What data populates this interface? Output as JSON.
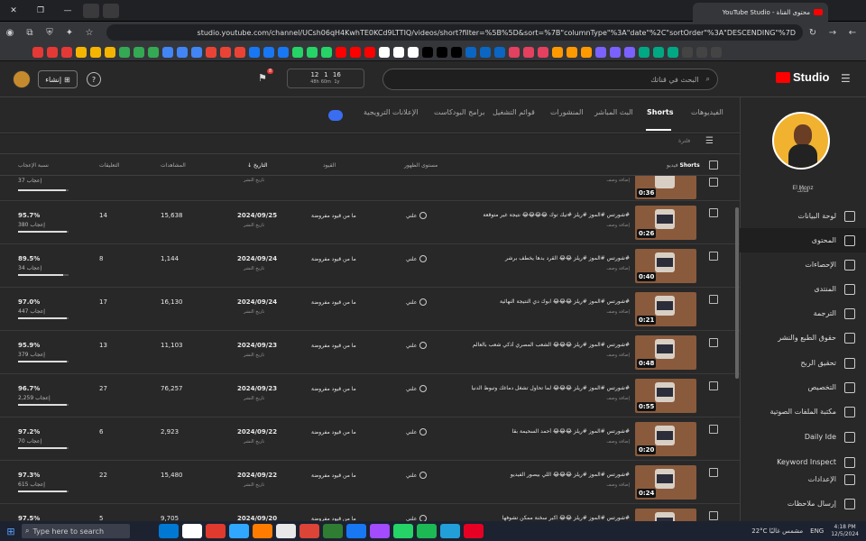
{
  "browser": {
    "tab_title": "محتوى القناة - YouTube Studio",
    "url": "studio.youtube.com/channel/UCsh06qH4KwhTE0KCd9LTTIQ/videos/short?filter=%5B%5D&sort=%7B\"columnType\"%3A\"date\"%2C\"sortOrder\"%3A\"DESCENDING\"%7D",
    "bookmark_colors": [
      "#e53935",
      "#f4b400",
      "#34a853",
      "#4285f4",
      "#ea4335",
      "#1877f2",
      "#25d366",
      "#ff0000",
      "#ffffff",
      "#000000",
      "#0a66c2",
      "#e4405f",
      "#ff9900",
      "#7b61ff",
      "#00a884",
      "#444444"
    ]
  },
  "header": {
    "search_placeholder": "البحث في قناتك",
    "logo_text": "Studio",
    "create_label": "إنشاء",
    "help_label": "?",
    "stats": [
      {
        "value": "12",
        "unit": "48h"
      },
      {
        "value": "1",
        "unit": "60m"
      },
      {
        "value": "16",
        "unit": "1y"
      }
    ],
    "notif_count": "8"
  },
  "channel": {
    "name": "El Monz",
    "subtitle": "قناتك"
  },
  "sidebar": {
    "items": [
      {
        "label": "لوحة البيانات",
        "icon": "dashboard-icon"
      },
      {
        "label": "المحتوى",
        "icon": "content-icon",
        "active": true
      },
      {
        "label": "الإحصاءات",
        "icon": "analytics-icon"
      },
      {
        "label": "المنتدى",
        "icon": "community-icon"
      },
      {
        "label": "الترجمة",
        "icon": "subtitles-icon"
      },
      {
        "label": "حقوق الطبع والنشر",
        "icon": "copyright-icon"
      },
      {
        "label": "تحقيق الربح",
        "icon": "earn-icon"
      },
      {
        "label": "التخصيص",
        "icon": "customization-icon"
      },
      {
        "label": "مكتبة الملفات الصوتية",
        "icon": "audio-library-icon"
      },
      {
        "label": "Daily Ide",
        "icon": "extension-icon"
      },
      {
        "label": "Keyword Inspect",
        "icon": "extension-icon"
      },
      {
        "label": "الإعدادات",
        "icon": "settings-icon"
      },
      {
        "label": "إرسال ملاحظات",
        "icon": "feedback-icon"
      }
    ]
  },
  "tabs": [
    {
      "label": "الفيديوهات"
    },
    {
      "label": "Shorts",
      "active": true
    },
    {
      "label": "البث المباشر"
    },
    {
      "label": "المنشورات"
    },
    {
      "label": "قوائم التشغيل"
    },
    {
      "label": "برامج البودكاست"
    },
    {
      "label": "الإعلانات الترويجية"
    }
  ],
  "filter_label": "فلترة",
  "columns": {
    "video": "Shorts",
    "video_prefix": "فيديو",
    "visibility": "مستوى الظهور",
    "restrictions": "القيود",
    "date": "التاريخ",
    "views": "المشاهدات",
    "comments": "التعليقات",
    "likes": "نسبة الإعجاب"
  },
  "first_row_partial": {
    "likes": "37",
    "likes_label": "إعجاب",
    "duration": "0:36",
    "desc": "إضافة وصف",
    "date_sub": "تاريخ النشر"
  },
  "rows": [
    {
      "duration": "0:26",
      "title": "#شورتس #الموز #ريلز #تيك توك 😂😂😂😂 نتيجة غير متوقعة",
      "desc": "إضافة وصف",
      "visibility": "علني",
      "restriction": "ما من قيود مفروضة",
      "date": "2024/09/25",
      "date_sub": "تاريخ النشر",
      "views": "15,638",
      "comments": "14",
      "like_pct": "95.7%",
      "likes": "380",
      "like_frac": 0.957
    },
    {
      "duration": "0:40",
      "title": "#شورتس #الموز #ريلز 😂😂 القرد بدها يخطف برشر",
      "desc": "إضافة وصف",
      "visibility": "علني",
      "restriction": "ما من قيود مفروضة",
      "date": "2024/09/24",
      "date_sub": "تاريخ النشر",
      "views": "1,144",
      "comments": "8",
      "like_pct": "89.5%",
      "likes": "34",
      "like_frac": 0.895
    },
    {
      "duration": "0:21",
      "title": "#شورتس #الموز #ريلز 😂😂😂 ابوك دي النتيجة النهائية",
      "desc": "إضافة وصف",
      "visibility": "علني",
      "restriction": "ما من قيود مفروضة",
      "date": "2024/09/24",
      "date_sub": "تاريخ النشر",
      "views": "16,130",
      "comments": "17",
      "like_pct": "97.0%",
      "likes": "447",
      "like_frac": 0.97
    },
    {
      "duration": "0:48",
      "title": "#شورتس #الموز #ريلز 😂😂😂 الشعب المصري أذكي شعب بالعالم",
      "desc": "إضافة وصف",
      "visibility": "علني",
      "restriction": "ما من قيود مفروضة",
      "date": "2024/09/23",
      "date_sub": "تاريخ النشر",
      "views": "11,103",
      "comments": "13",
      "like_pct": "95.9%",
      "likes": "379",
      "like_frac": 0.959
    },
    {
      "duration": "0:55",
      "title": "#شورتس #الموز #ريلز 😂😂😂 لما تحاول تشغل دماغك وتبوظ الدنيا",
      "desc": "إضافة وصف",
      "visibility": "علني",
      "restriction": "ما من قيود مفروضة",
      "date": "2024/09/23",
      "date_sub": "تاريخ النشر",
      "views": "76,257",
      "comments": "27",
      "like_pct": "96.7%",
      "likes": "2,259",
      "like_frac": 0.967
    },
    {
      "duration": "0:20",
      "title": "#شورتس #الموز #ريلز 😂😂😂 أحمد السحيمة بقا",
      "desc": "إضافة وصف",
      "visibility": "علني",
      "restriction": "ما من قيود مفروضة",
      "date": "2024/09/22",
      "date_sub": "تاريخ النشر",
      "views": "2,923",
      "comments": "6",
      "like_pct": "97.2%",
      "likes": "70",
      "like_frac": 0.972
    },
    {
      "duration": "0:24",
      "title": "#شورتس #الموز #ريلز 😂😂😂 اللي بيصور الفيديو",
      "desc": "إضافة وصف",
      "visibility": "علني",
      "restriction": "ما من قيود مفروضة",
      "date": "2024/09/22",
      "date_sub": "تاريخ النشر",
      "views": "15,480",
      "comments": "22",
      "like_pct": "97.3%",
      "likes": "615",
      "like_frac": 0.973
    },
    {
      "duration": "",
      "title": "#شورتس #الموز #ريلز 😂😂 اكبر سخنة ممكن تشوفها",
      "desc": "إضافة وصف",
      "visibility": "علني",
      "restriction": "ما من قيود مفروضة",
      "date": "2024/09/20",
      "date_sub": "تاريخ النشر",
      "views": "9,705",
      "comments": "5",
      "like_pct": "97.5%",
      "likes": "",
      "like_frac": 0.975
    }
  ],
  "taskbar": {
    "search_placeholder": "Type here to search",
    "weather": "22°C مشمس غالبًا",
    "lang": "ENG",
    "time": "4:18 PM",
    "date": "12/5/2024",
    "app_colors": [
      "#0078d4",
      "#ffffff",
      "#e03a2e",
      "#31a8ff",
      "#ff7c00",
      "#e8e8e8",
      "#db4437",
      "#2e7d32",
      "#1877f2",
      "#a24bff",
      "#25d366",
      "#1db954",
      "#229ed9",
      "#e60023"
    ]
  }
}
